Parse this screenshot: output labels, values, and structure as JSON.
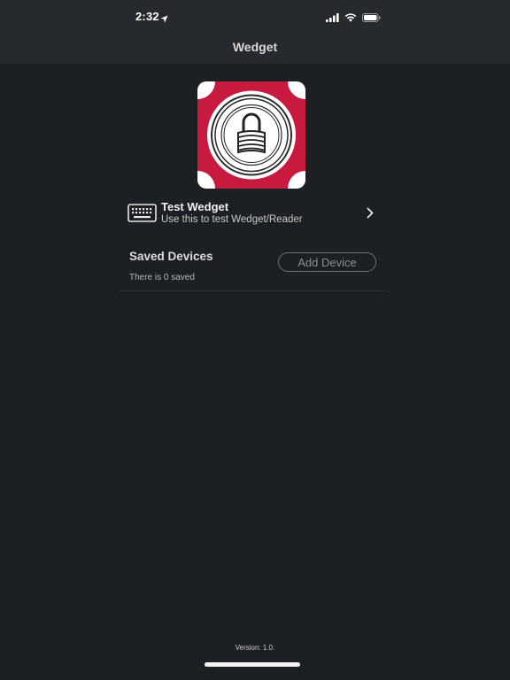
{
  "status_bar": {
    "time": "2:32",
    "icons": [
      "location-arrow-icon",
      "signal-icon",
      "wifi-icon",
      "battery-icon"
    ]
  },
  "nav": {
    "title": "Wedget"
  },
  "logo": {
    "icon": "padlock-logo",
    "colors": {
      "background": "#c8193f",
      "ring": "#ffffff",
      "stroke": "#2a2a2a"
    }
  },
  "test_widget": {
    "icon": "keyboard-icon",
    "title": "Test Wedget",
    "subtitle": "Use this to test Wedget/Reader",
    "trailing_icon": "chevron-right-icon"
  },
  "saved_devices": {
    "title": "Saved Devices",
    "count_text": "There is 0 saved",
    "add_button_label": "Add Device"
  },
  "footer": {
    "version": "Version: 1.0."
  },
  "colors": {
    "background": "#1c1f23",
    "top_bar": "#26292d",
    "text_primary": "#f2f2f2",
    "button_border": "#6e7176"
  }
}
